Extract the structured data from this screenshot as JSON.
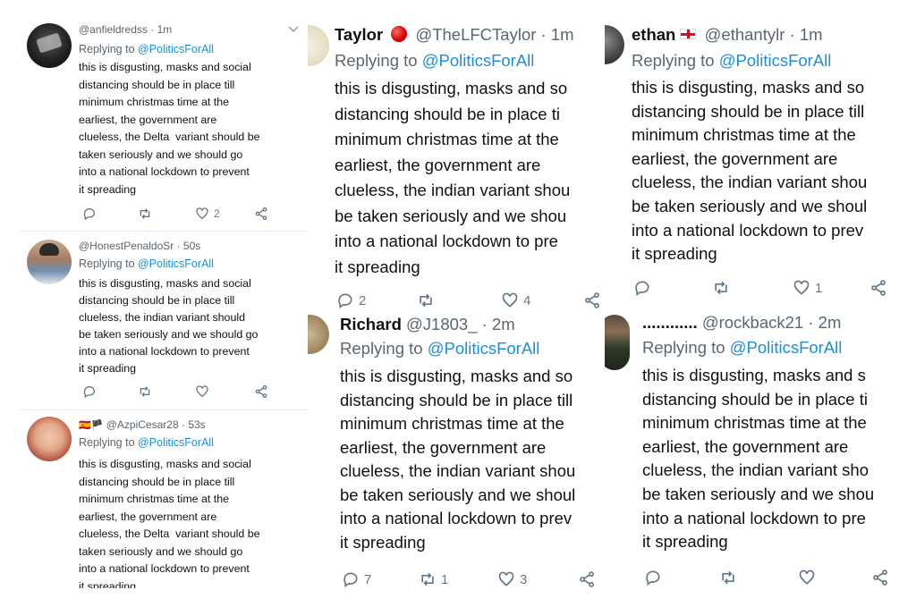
{
  "colors": {
    "link": "#1d8fd8",
    "muted": "#657786"
  },
  "tweets": [
    {
      "name": "",
      "handle": "@anfieldredss",
      "time": "· 1m",
      "reply_prefix": "Replying to ",
      "reply_to": "@PoliticsForAll",
      "body": "this is disgusting, masks and social\ndistancing should be in place till\nminimum christmas time at the\nearliest, the government are\nclueless, the Delta  variant should be\ntaken seriously and we should go\ninto a national lockdown to prevent\nit spreading",
      "replies": "",
      "retweets": "",
      "likes": "2"
    },
    {
      "name": "",
      "handle": "@HonestPenaldoSr",
      "time": "· 50s",
      "reply_prefix": "Replying to ",
      "reply_to": "@PoliticsForAll",
      "body": "this is disgusting, masks and social\ndistancing should be in place till\nclueless, the indian variant should\nbe taken seriously and we should go\ninto a national lockdown to prevent\nit spreading",
      "replies": "",
      "retweets": "",
      "likes": ""
    },
    {
      "name": "🇪🇸🏴",
      "handle": "@AzpiCesar28",
      "time": "· 53s",
      "reply_prefix": "Replying to ",
      "reply_to": "@PoliticsForAll",
      "body": "this is disgusting, masks and social\ndistancing should be in place till\nminimum christmas time at the\nearliest, the government are\nclueless, the Delta  variant should be\ntaken seriously and we should go\ninto a national lockdown to prevent\nit spreading",
      "replies": "",
      "retweets": "",
      "likes": ""
    },
    {
      "name": "Taylor",
      "handle": "@TheLFCTaylor",
      "time": "· 1m",
      "reply_prefix": "Replying to ",
      "reply_to": "@PoliticsForAll",
      "body": "this is disgusting, masks and so\ndistancing should be in place ti\nminimum christmas time at the\nearliest, the government are\nclueless, the indian variant shou\nbe taken seriously and we shou\ninto a national lockdown to pre\nit spreading",
      "replies": "2",
      "retweets": "",
      "likes": "4"
    },
    {
      "name": "Richard",
      "handle": "@J1803_",
      "time": "· 2m",
      "reply_prefix": "Replying to ",
      "reply_to": "@PoliticsForAll",
      "body": "this is disgusting, masks and so\ndistancing should be in place till\nminimum christmas time at the\nearliest, the government are\nclueless, the indian variant shou\nbe taken seriously and we shoul\ninto a national lockdown to prev\nit spreading",
      "replies": "7",
      "retweets": "1",
      "likes": "3"
    },
    {
      "name": "ethan",
      "handle": "@ethantylr",
      "time": "· 1m",
      "reply_prefix": "Replying to ",
      "reply_to": "@PoliticsForAll",
      "body": "this is disgusting, masks and so\ndistancing should be in place till\nminimum christmas time at the\nearliest, the government are\nclueless, the indian variant shou\nbe taken seriously and we shoul\ninto a national lockdown to prev\nit spreading",
      "replies": "",
      "retweets": "",
      "likes": "1"
    },
    {
      "name": "............",
      "handle": "@rockback21",
      "time": "· 2m",
      "reply_prefix": "Replying to ",
      "reply_to": "@PoliticsForAll",
      "body": "this is disgusting, masks and s\ndistancing should be in place ti\nminimum christmas time at the\nearliest, the government are\nclueless, the indian variant sho\nbe taken seriously and we shou\ninto a national lockdown to pre\nit spreading",
      "replies": "",
      "retweets": "",
      "likes": ""
    }
  ]
}
